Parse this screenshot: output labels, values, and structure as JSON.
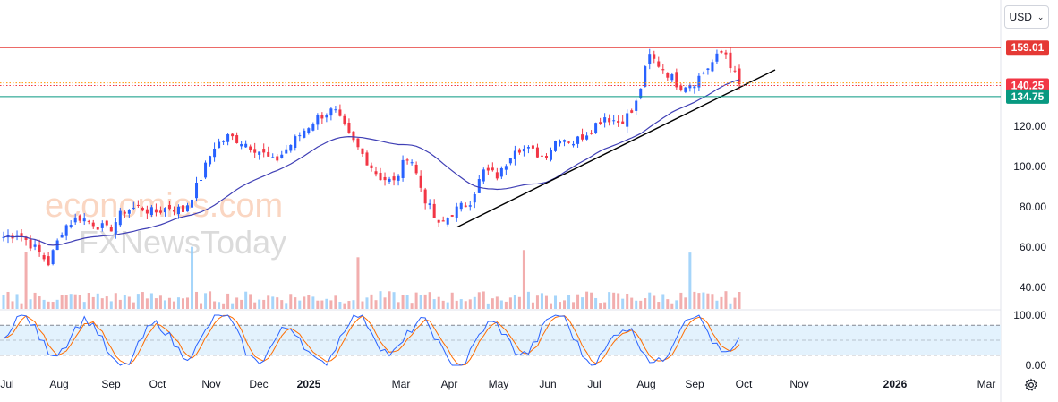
{
  "toolbar": {
    "currency_label": "USD",
    "currency_icon": "chevron-down-icon",
    "settings_icon": "gear-icon"
  },
  "watermark": {
    "line1": "economies.com",
    "line2": "FXNewsToday"
  },
  "colors": {
    "up": "#2962ff",
    "down": "#f23645",
    "ma": "#3f3fb5",
    "trend": "#000000",
    "resistance": "#e53935",
    "support": "#089981",
    "k": "#2962ff",
    "d": "#ff6d00",
    "stochBand": "#e3f2fd",
    "axisText": "#131722"
  },
  "chart_data": {
    "type": "candlestick",
    "title": "",
    "y_axis": {
      "ticks": [
        "40.00",
        "60.00",
        "80.00",
        "100.00",
        "120.00"
      ],
      "ylim": [
        30,
        172
      ]
    },
    "x_axis": {
      "labels": [
        "Jul",
        "Aug",
        "Sep",
        "Oct",
        "Nov",
        "Dec",
        "2025",
        "Mar",
        "Apr",
        "May",
        "Jun",
        "Jul",
        "Aug",
        "Sep",
        "Oct",
        "Nov",
        "2026",
        "Mar"
      ],
      "bold": [
        "2025",
        "2026"
      ]
    },
    "price_levels": [
      {
        "label": "159.01",
        "value": 159.01,
        "style": "solid",
        "color": "#e53935"
      },
      {
        "label": "140.25",
        "value": 140.25,
        "style": "dotted",
        "color": "#f23645"
      },
      {
        "label": "134.75",
        "value": 134.75,
        "style": "solid",
        "color": "#089981"
      }
    ],
    "extra_dotted_level": 141.5,
    "trendline": {
      "from": {
        "x": "Apr",
        "y": 70
      },
      "to": {
        "x": "Oct-Nov",
        "y": 148
      }
    },
    "price_path": [
      [
        "Jul",
        65
      ],
      [
        "Jul+",
        67
      ],
      [
        "Aug-",
        60
      ],
      [
        "Aug",
        52
      ],
      [
        "Aug+",
        70
      ],
      [
        "Aug++",
        75
      ],
      [
        "Sep",
        72
      ],
      [
        "Sep+",
        68
      ],
      [
        "Sep++",
        78
      ],
      [
        "Oct",
        80
      ],
      [
        "Oct+",
        77
      ],
      [
        "Oct++",
        80
      ],
      [
        "Nov-",
        78
      ],
      [
        "Nov",
        92
      ],
      [
        "Nov+",
        110
      ],
      [
        "Dec-",
        115
      ],
      [
        "Dec",
        112
      ],
      [
        "Dec+",
        108
      ],
      [
        "Dec++",
        102
      ],
      [
        "2025",
        110
      ],
      [
        "Jan+",
        118
      ],
      [
        "Jan++",
        125
      ],
      [
        "Feb",
        128
      ],
      [
        "Feb+",
        115
      ],
      [
        "Feb++",
        105
      ],
      [
        "Mar",
        95
      ],
      [
        "Mar+",
        92
      ],
      [
        "Mar++",
        107
      ],
      [
        "Apr-",
        85
      ],
      [
        "Apr",
        70
      ],
      [
        "Apr+",
        78
      ],
      [
        "Apr++",
        82
      ],
      [
        "May",
        98
      ],
      [
        "May+",
        95
      ],
      [
        "Jun-",
        110
      ],
      [
        "Jun",
        108
      ],
      [
        "Jun+",
        105
      ],
      [
        "Jun++",
        115
      ],
      [
        "Jul",
        112
      ],
      [
        "Jul+",
        118
      ],
      [
        "Jul++",
        125
      ],
      [
        "Aug-",
        122
      ],
      [
        "Aug",
        128
      ],
      [
        "Aug+",
        155
      ],
      [
        "Aug++",
        148
      ],
      [
        "Sep-",
        140
      ],
      [
        "Sep",
        142
      ],
      [
        "Sep+",
        150
      ],
      [
        "Sep++",
        158
      ],
      [
        "Oct-",
        140
      ]
    ],
    "moving_average": {
      "label": "",
      "trend": "rising"
    },
    "stochastic": {
      "ticks": [
        "100.00",
        "0.00"
      ],
      "upper": 80,
      "lower": 20,
      "mid": 50
    }
  }
}
